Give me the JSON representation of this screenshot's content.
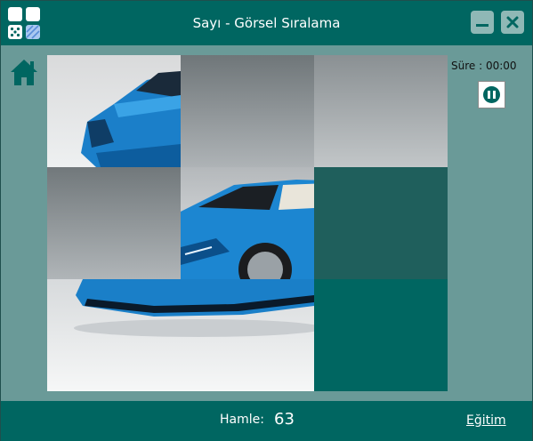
{
  "window": {
    "title": "Sayı - Görsel Sıralama",
    "logo_icon": "puzzle-grid-icon",
    "minimize_icon": "minimize-icon",
    "close_icon": "close-icon"
  },
  "sidebar": {
    "home_icon": "home-icon"
  },
  "status": {
    "timer_label": "Süre : 00:00",
    "pause_icon": "pause-icon"
  },
  "puzzle": {
    "grid_rows": 3,
    "grid_cols": 3,
    "image_subject": "blue convertible sports car",
    "empty_tile": {
      "row": 3,
      "col": 3
    }
  },
  "footer": {
    "moves_label": "Hamle:",
    "moves_value": "63",
    "tutorial_link": "Eğitim"
  },
  "colors": {
    "titlebar": "#006661",
    "background": "#6a9a98",
    "accent_car": "#1e88d4",
    "empty_tile": "#006661"
  }
}
